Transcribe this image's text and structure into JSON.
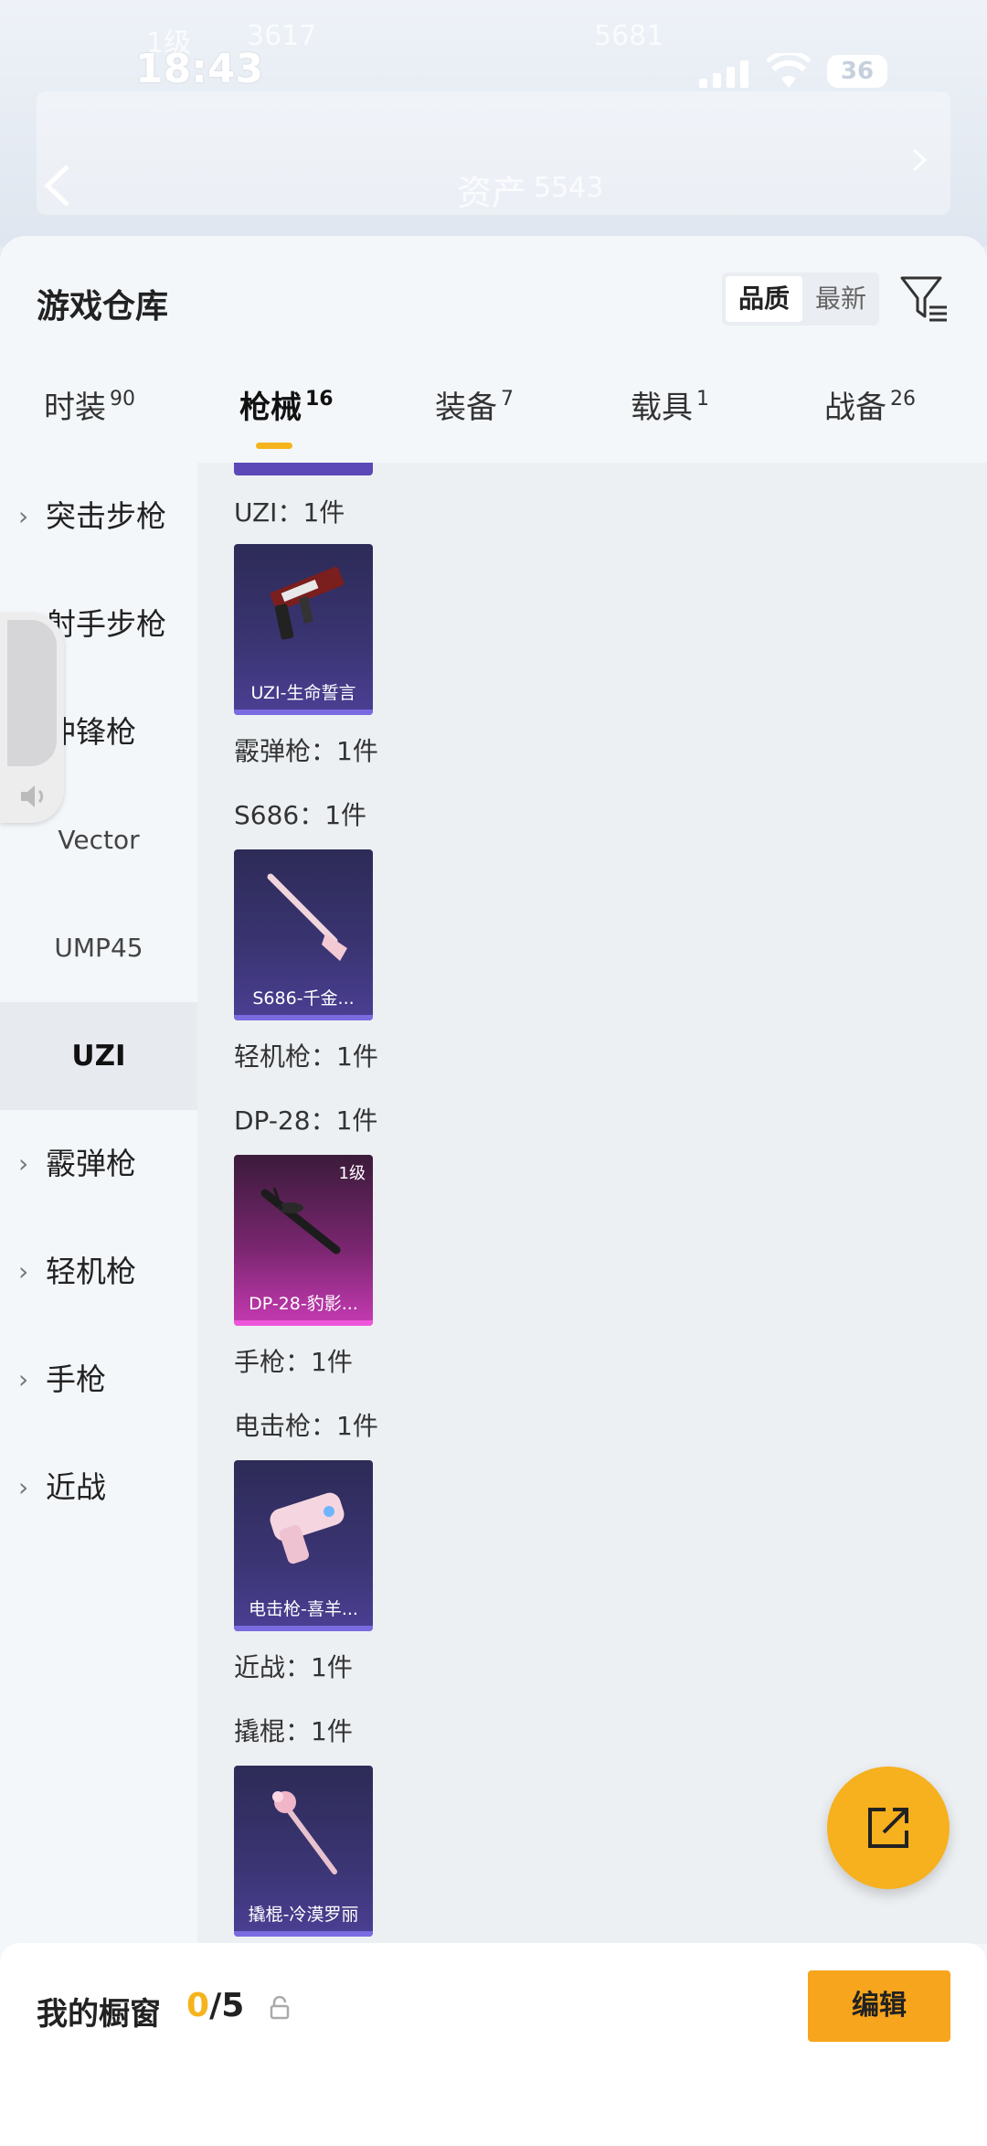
{
  "status_bar": {
    "time": "18:43",
    "battery": "36"
  },
  "background": {
    "asset_label": "资产",
    "asset_value": "5543",
    "level_label": "1级",
    "stat_a": "3617",
    "stat_b": "5681"
  },
  "sheet": {
    "title": "游戏仓库",
    "sort_options": [
      "品质",
      "最新"
    ],
    "tabs": [
      {
        "label": "时装",
        "count": "90"
      },
      {
        "label": "枪械",
        "count": "16"
      },
      {
        "label": "装备",
        "count": "7"
      },
      {
        "label": "载具",
        "count": "1"
      },
      {
        "label": "战备",
        "count": "26"
      }
    ]
  },
  "leftnav": {
    "categories": [
      "突击步枪",
      "射手步枪",
      "冲锋枪"
    ],
    "subitems": [
      "Vector",
      "UMP45",
      "UZI"
    ],
    "lower_categories": [
      "霰弹枪",
      "轻机枪",
      "手枪",
      "近战"
    ]
  },
  "content": {
    "rows": [
      "UZI：1件",
      "霰弹枪：1件",
      "S686：1件",
      "轻机枪：1件",
      "DP-28：1件",
      "手枪：1件",
      "电击枪：1件",
      "近战：1件",
      "撬棍：1件"
    ],
    "cards": [
      {
        "name": "UZI-生命誓言"
      },
      {
        "name": "S686-千金..."
      },
      {
        "name": "DP-28-豹影...",
        "level": "1级"
      },
      {
        "name": "电击枪-喜羊..."
      },
      {
        "name": "撬棍-冷漠罗丽"
      }
    ]
  },
  "bottom_bar": {
    "title": "我的橱窗",
    "count_current": "0",
    "count_total": "/5",
    "edit_label": "编辑"
  },
  "colors": {
    "accent": "#f5b41c",
    "card_purple": "#3b3574",
    "card_pink": "#c73ab4"
  }
}
